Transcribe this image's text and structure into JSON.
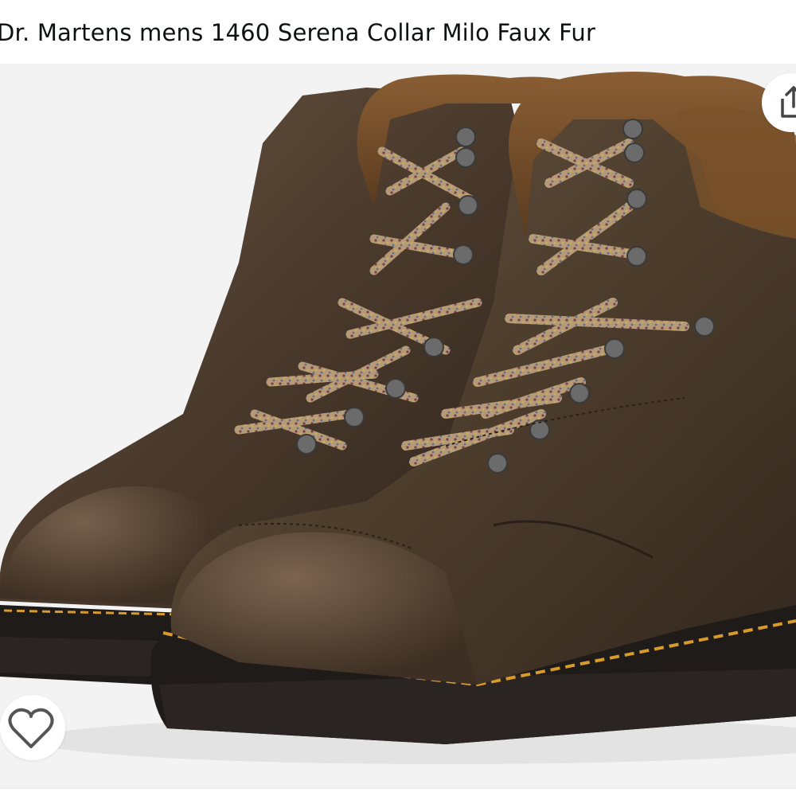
{
  "product": {
    "title": "Dr. Martens mens 1460 Serena Collar Milo Faux Fur",
    "image_alt": "Brown leather lace-up boots with faux fur collar"
  },
  "actions": {
    "share_icon": "share-icon",
    "wishlist_icon": "heart-outline-icon"
  },
  "colors": {
    "background": "#f3f3f3",
    "leather": "#4a3a2c",
    "fur": "#6b4726",
    "sole": "#1e1b19",
    "stitch": "#d89a2a",
    "icon": "#444444"
  }
}
